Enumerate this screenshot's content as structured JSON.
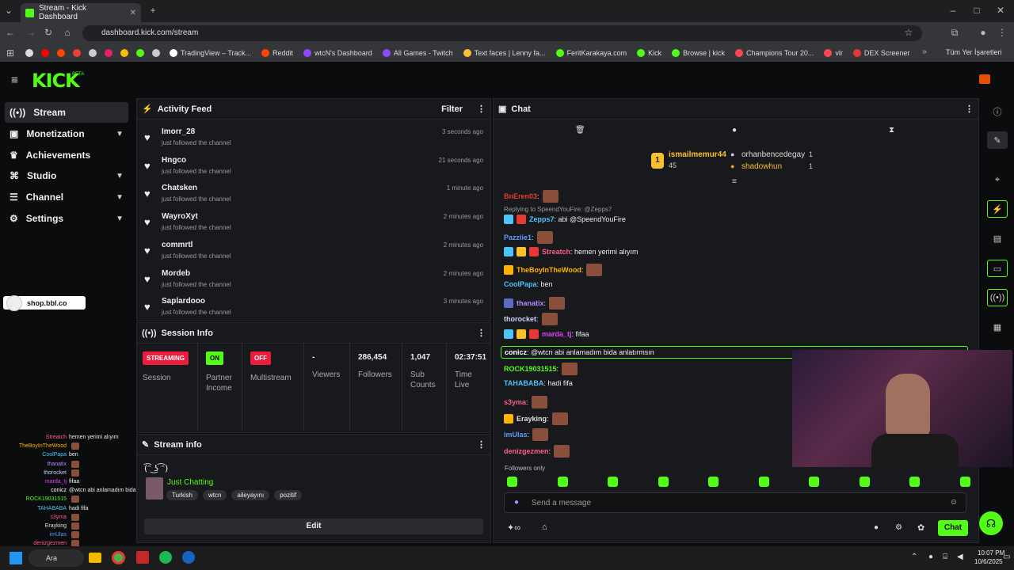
{
  "browser": {
    "tab_title": "Stream - Kick Dashboard",
    "url": "dashboard.kick.com/stream",
    "bookmarks": [
      "TradingView – Track...",
      "Reddit",
      "wtcN's Dashboard",
      "All Games - Twitch",
      "Text faces | Lenny fa...",
      "FeritKarakaya.com",
      "Kick",
      "Browse | kick",
      "Champions Tour 20...",
      "vlr",
      "DEX Screener"
    ],
    "other_bookmarks": "Tüm Yer İşaretleri"
  },
  "header": {
    "logo": "KICK",
    "logo_sup": "BETA"
  },
  "sidebar": {
    "items": [
      {
        "label": "Stream"
      },
      {
        "label": "Monetization"
      },
      {
        "label": "Achievements"
      },
      {
        "label": "Studio"
      },
      {
        "label": "Channel"
      },
      {
        "label": "Settings"
      }
    ],
    "shop": "shop.bbl.co"
  },
  "activity": {
    "title": "Activity Feed",
    "filter": "Filter",
    "items": [
      {
        "user": "Imorr_28",
        "action": "just followed the channel",
        "time": "3 seconds ago"
      },
      {
        "user": "Hngco",
        "action": "just followed the channel",
        "time": "21 seconds ago"
      },
      {
        "user": "Chatsken",
        "action": "just followed the channel",
        "time": "1 minute ago"
      },
      {
        "user": "WayroXyt",
        "action": "just followed the channel",
        "time": "2 minutes ago"
      },
      {
        "user": "commrtl",
        "action": "just followed the channel",
        "time": "2 minutes ago"
      },
      {
        "user": "Mordeb",
        "action": "just followed the channel",
        "time": "2 minutes ago"
      },
      {
        "user": "Saplardooo",
        "action": "just followed the channel",
        "time": "3 minutes ago"
      }
    ]
  },
  "session": {
    "title": "Session Info",
    "streaming_badge": "STREAMING",
    "session_label": "Session",
    "on_badge": "ON",
    "partner_label": "Partner Income",
    "off_badge": "OFF",
    "multistream_label": "Multistream",
    "viewers_value": "-",
    "viewers_label": "Viewers",
    "followers_value": "286,454",
    "followers_label": "Followers",
    "subs_value": "1,047",
    "subs_label": "Sub Counts",
    "time_value": "02:37:51",
    "time_label": "Time Live"
  },
  "stream_info": {
    "title": "Stream info",
    "stream_title": "(͡ᵔ ͜ʖ ͡ᵔ)",
    "category": "Just Chatting",
    "tags": [
      "Turkish",
      "wtcn",
      "aileyayını",
      "pozitif"
    ],
    "edit": "Edit"
  },
  "chat": {
    "title": "Chat",
    "leaderboard": [
      {
        "name": "ismailmemur44",
        "count": "45"
      },
      {
        "name": "orhanbencedegay",
        "count": "1"
      },
      {
        "name": "shadowhun",
        "count": "1"
      }
    ],
    "reply_context": "Replying to SpeendYouFire: @Zepps7",
    "messages": [
      {
        "user": "BnEren03",
        "text": ":",
        "color": "#e53935"
      },
      {
        "user": "Zepps7",
        "text": ": abi @SpeendYouFire",
        "color": "#4fc3f7"
      },
      {
        "user": "Pazziie1",
        "text": ":",
        "color": "#5c9cff"
      },
      {
        "user": "Streatch",
        "text": ": hemen yerimi alıyım",
        "color": "#ff5c8a"
      },
      {
        "user": "TheBoyInTheWood",
        "text": ":",
        "color": "#ffb300"
      },
      {
        "user": "CoolPapa",
        "text": ": ben",
        "color": "#4fc3f7"
      },
      {
        "user": "thanatix",
        "text": ":",
        "color": "#b388ff"
      },
      {
        "user": "thorocket",
        "text": ":",
        "color": "#d0d0ff"
      },
      {
        "user": "marda_tj",
        "text": ": fifaa",
        "color": "#e040fb"
      },
      {
        "user": "conicz",
        "text": ": @wtcn abi anlamadım bida anlatırmsın",
        "color": "#ffffff"
      },
      {
        "user": "ROCK19031515",
        "text": ":",
        "color": "#53fc18"
      },
      {
        "user": "TAHABABA",
        "text": ": hadi fifa",
        "color": "#4fc3f7"
      },
      {
        "user": "s3yma",
        "text": ":",
        "color": "#ff5c8a"
      },
      {
        "user": "Erayking",
        "text": ":",
        "color": "#e0e0e0"
      },
      {
        "user": "imUlas",
        "text": ":",
        "color": "#5c9cff"
      },
      {
        "user": "denizgezmen",
        "text": ":",
        "color": "#ff5c8a"
      }
    ],
    "followers_only": "Followers only",
    "placeholder": "Send a message",
    "send": "Chat"
  },
  "overlay_chat": [
    {
      "user": "Streatch",
      "text": "hemen yerimi alıyım",
      "color": "#ff5c8a"
    },
    {
      "user": "TheBoyInTheWood",
      "text": "",
      "color": "#ffb300"
    },
    {
      "user": "CoolPapa",
      "text": "ben",
      "color": "#4fc3f7"
    },
    {
      "user": "thanatix",
      "text": "",
      "color": "#b388ff"
    },
    {
      "user": "thorocket",
      "text": "",
      "color": "#d0d0ff"
    },
    {
      "user": "marda_tj",
      "text": "fifaa",
      "color": "#e040fb"
    },
    {
      "user": "conicz",
      "text": "@wtcn abi anlamadım bida anlatırmsın",
      "color": "#ffffff"
    },
    {
      "user": "ROCK19031515",
      "text": "",
      "color": "#53fc18"
    },
    {
      "user": "TAHABABA",
      "text": "hadi fifa",
      "color": "#4fc3f7"
    },
    {
      "user": "s3yma",
      "text": "",
      "color": "#ff5c8a"
    },
    {
      "user": "Erayking",
      "text": "",
      "color": "#e0e0e0"
    },
    {
      "user": "imUlas",
      "text": "",
      "color": "#5c9cff"
    },
    {
      "user": "denizgezmen",
      "text": "",
      "color": "#ff5c8a"
    }
  ],
  "taskbar": {
    "search": "Ara",
    "time": "10:07 PM",
    "date": "10/6/2025"
  },
  "colors": {
    "accent": "#53fc18",
    "streaming": "#e91e3c",
    "panel": "#18191c"
  }
}
